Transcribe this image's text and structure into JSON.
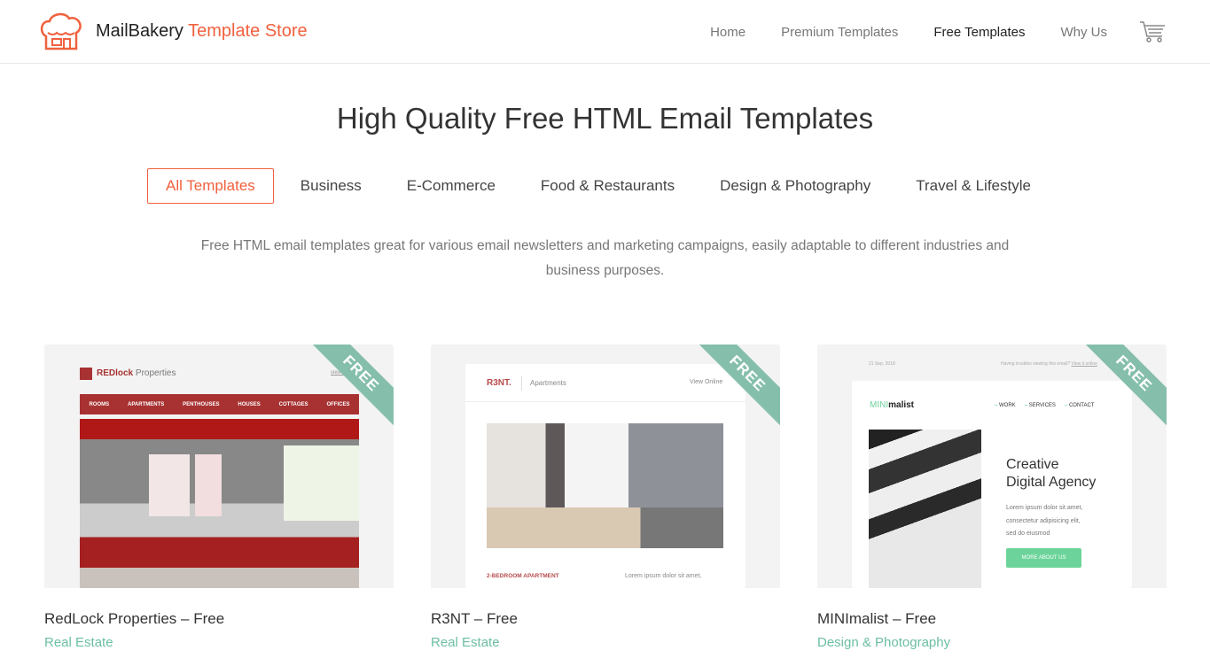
{
  "brand": {
    "name": "MailBakery",
    "suffix": "Template Store",
    "accent": "#f0613e"
  },
  "nav": {
    "items": [
      {
        "label": "Home"
      },
      {
        "label": "Premium Templates"
      },
      {
        "label": "Free Templates",
        "active": true
      },
      {
        "label": "Why Us"
      }
    ],
    "cart_icon": "cart-icon"
  },
  "page": {
    "title": "High Quality Free HTML Email Templates",
    "description": "Free HTML email templates great for various email newsletters and marketing campaigns, easily adaptable to different industries and business purposes."
  },
  "tabs": [
    {
      "label": "All Templates",
      "active": true
    },
    {
      "label": "Business"
    },
    {
      "label": "E-Commerce"
    },
    {
      "label": "Food & Restaurants"
    },
    {
      "label": "Design & Photography"
    },
    {
      "label": "Travel & Lifestyle"
    }
  ],
  "cards": [
    {
      "title": "RedLock Properties – Free",
      "category": "Real Estate",
      "badge": "FREE",
      "preview": {
        "brand_bold": "REDlock",
        "brand_rest": " Properties",
        "link": "view online",
        "menu": [
          "ROOMS",
          "APARTMENTS",
          "PENTHOUSES",
          "HOUSES",
          "COTTAGES",
          "OFFICES"
        ]
      }
    },
    {
      "title": "R3NT – Free",
      "category": "Real Estate",
      "badge": "FREE",
      "preview": {
        "brand": "R3NT.",
        "sub": "Apartments",
        "link": "View Online",
        "heading": "2-BEDROOM APARTMENT",
        "text": "Lorem ipsum dolor sit amet,"
      }
    },
    {
      "title": "MINImalist – Free",
      "category": "Design & Photography",
      "badge": "FREE",
      "preview": {
        "date": "21 Sep, 2018",
        "trouble": "Having troubles viewing this email?",
        "trouble_link": "View it online",
        "brand_a": "MINI",
        "brand_b": "malist",
        "menu": [
          "WORK",
          "SERVICES",
          "CONTACT"
        ],
        "heading1": "Creative",
        "heading2": "Digital Agency",
        "text": [
          "Lorem ipsum dolor sit amet,",
          "consectetur adipisicing elit,",
          "sed do eiusmod"
        ],
        "button": "MORE ABOUT US"
      }
    }
  ]
}
